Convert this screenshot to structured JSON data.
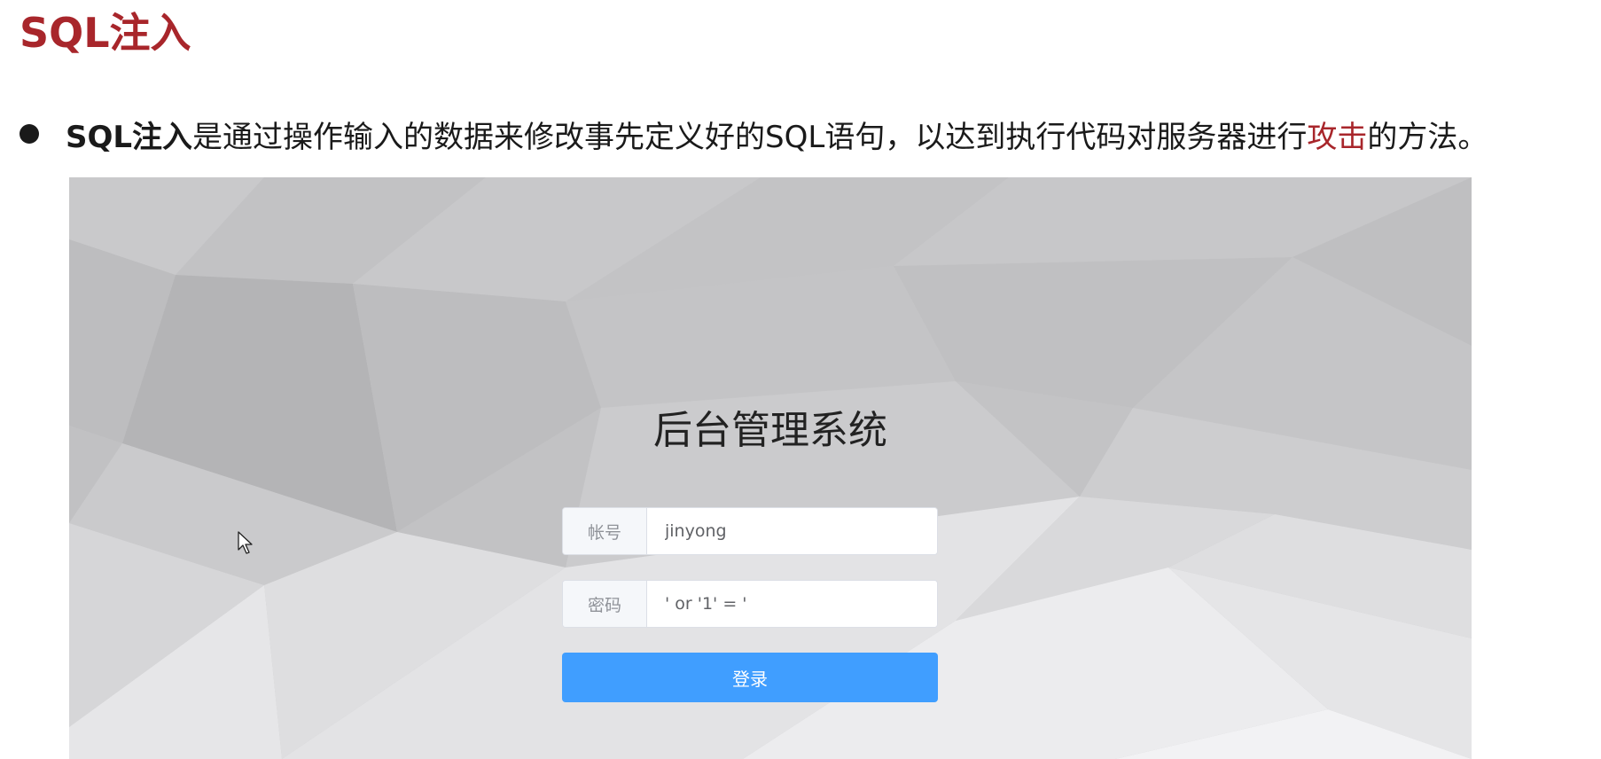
{
  "slide": {
    "title": "SQL注入",
    "bullet": {
      "strong": "SQL注入",
      "text_before": "是通过操作输入的数据来修改事先定义好的SQL语句，以达到执行代码对服务器进行",
      "highlight": "攻击",
      "text_after": "的方法。"
    }
  },
  "login": {
    "title": "后台管理系统",
    "account_label": "帐号",
    "account_value": "jinyong",
    "password_label": "密码",
    "password_value": "' or '1' = '",
    "submit_label": "登录"
  },
  "colors": {
    "title_red": "#a8262b",
    "button_blue": "#409eff",
    "background_gray": "#c4c4c6"
  }
}
